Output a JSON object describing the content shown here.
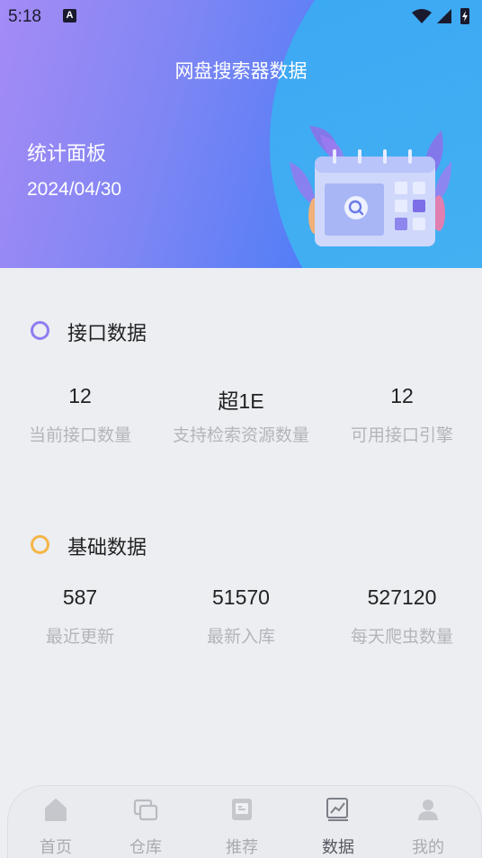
{
  "status_bar": {
    "time": "5:18",
    "notification_icon": "A"
  },
  "header": {
    "title": "网盘搜索器数据"
  },
  "board": {
    "title": "统计面板",
    "date": "2024/04/30"
  },
  "sections": [
    {
      "title": "接口数据",
      "ring_color": "#8f7cf2",
      "stats": [
        {
          "value": "12",
          "label": "当前接口数量"
        },
        {
          "value": "超1E",
          "label": "支持检索资源数量"
        },
        {
          "value": "12",
          "label": "可用接口引擎"
        }
      ]
    },
    {
      "title": "基础数据",
      "ring_color": "#f5b545",
      "stats": [
        {
          "value": "587",
          "label": "最近更新"
        },
        {
          "value": "51570",
          "label": "最新入库"
        },
        {
          "value": "527120",
          "label": "每天爬虫数量"
        }
      ]
    }
  ],
  "tabbar": {
    "items": [
      {
        "label": "首页",
        "icon": "home-icon"
      },
      {
        "label": "仓库",
        "icon": "repository-icon"
      },
      {
        "label": "推荐",
        "icon": "recommend-icon"
      },
      {
        "label": "数据",
        "icon": "chart-icon",
        "active": true
      },
      {
        "label": "我的",
        "icon": "profile-icon"
      }
    ]
  }
}
